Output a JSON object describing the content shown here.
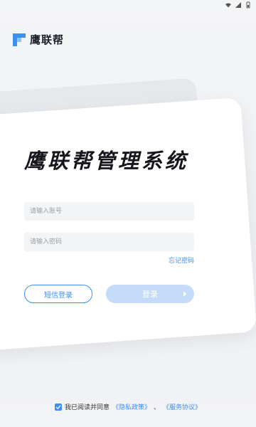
{
  "brand": {
    "name": "鹰联帮"
  },
  "login": {
    "title": "鹰联帮管理系统",
    "account_placeholder": "请输入账号",
    "password_placeholder": "请输入密码",
    "forgot_label": "忘记密码",
    "sms_label": "短信登录",
    "login_label": "登录"
  },
  "agreement": {
    "text": "我已阅读并同意",
    "privacy_link": "《隐私政策》",
    "separator": "、",
    "service_link": "《服务协议》",
    "checked": true
  },
  "colors": {
    "accent": "#3b8ff2",
    "login_button_disabled": "#c4dcf9",
    "card_background": "#ffffff"
  }
}
